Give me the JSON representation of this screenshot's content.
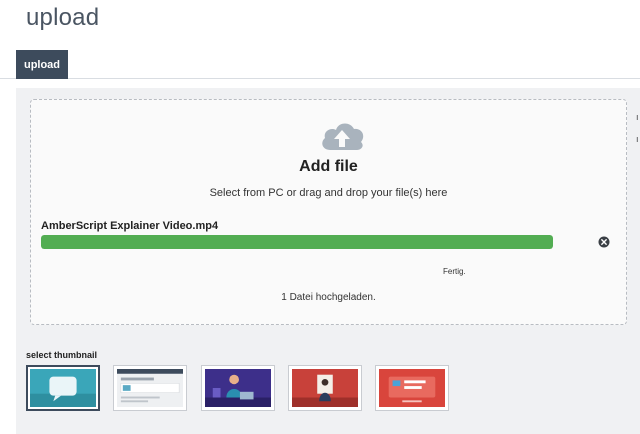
{
  "page": {
    "title": "upload"
  },
  "tabs": [
    {
      "label": "upload",
      "active": true
    }
  ],
  "dropzone": {
    "icon": "cloud-upload-icon",
    "heading": "Add file",
    "subtitle": "Select from PC or drag and drop your file(s) here",
    "file": {
      "name": "AmberScript Explainer Video.mp4",
      "progress_percent": 100,
      "status": "Fertig.",
      "remove_icon": "close-circle-icon"
    },
    "summary": "1 Datei hochgeladen."
  },
  "thumbnails": {
    "label": "select thumbnail",
    "selected_index": 0,
    "items": [
      {
        "description": "speech bubble on teal background"
      },
      {
        "description": "browser screenshot"
      },
      {
        "description": "person at laptop on purple background"
      },
      {
        "description": "person reading on red background"
      },
      {
        "description": "Amber Script logo on red background"
      }
    ]
  },
  "colors": {
    "tab_active": "#3d4b5c",
    "progress": "#52ad52",
    "panel_bg": "#f0f1f3"
  }
}
